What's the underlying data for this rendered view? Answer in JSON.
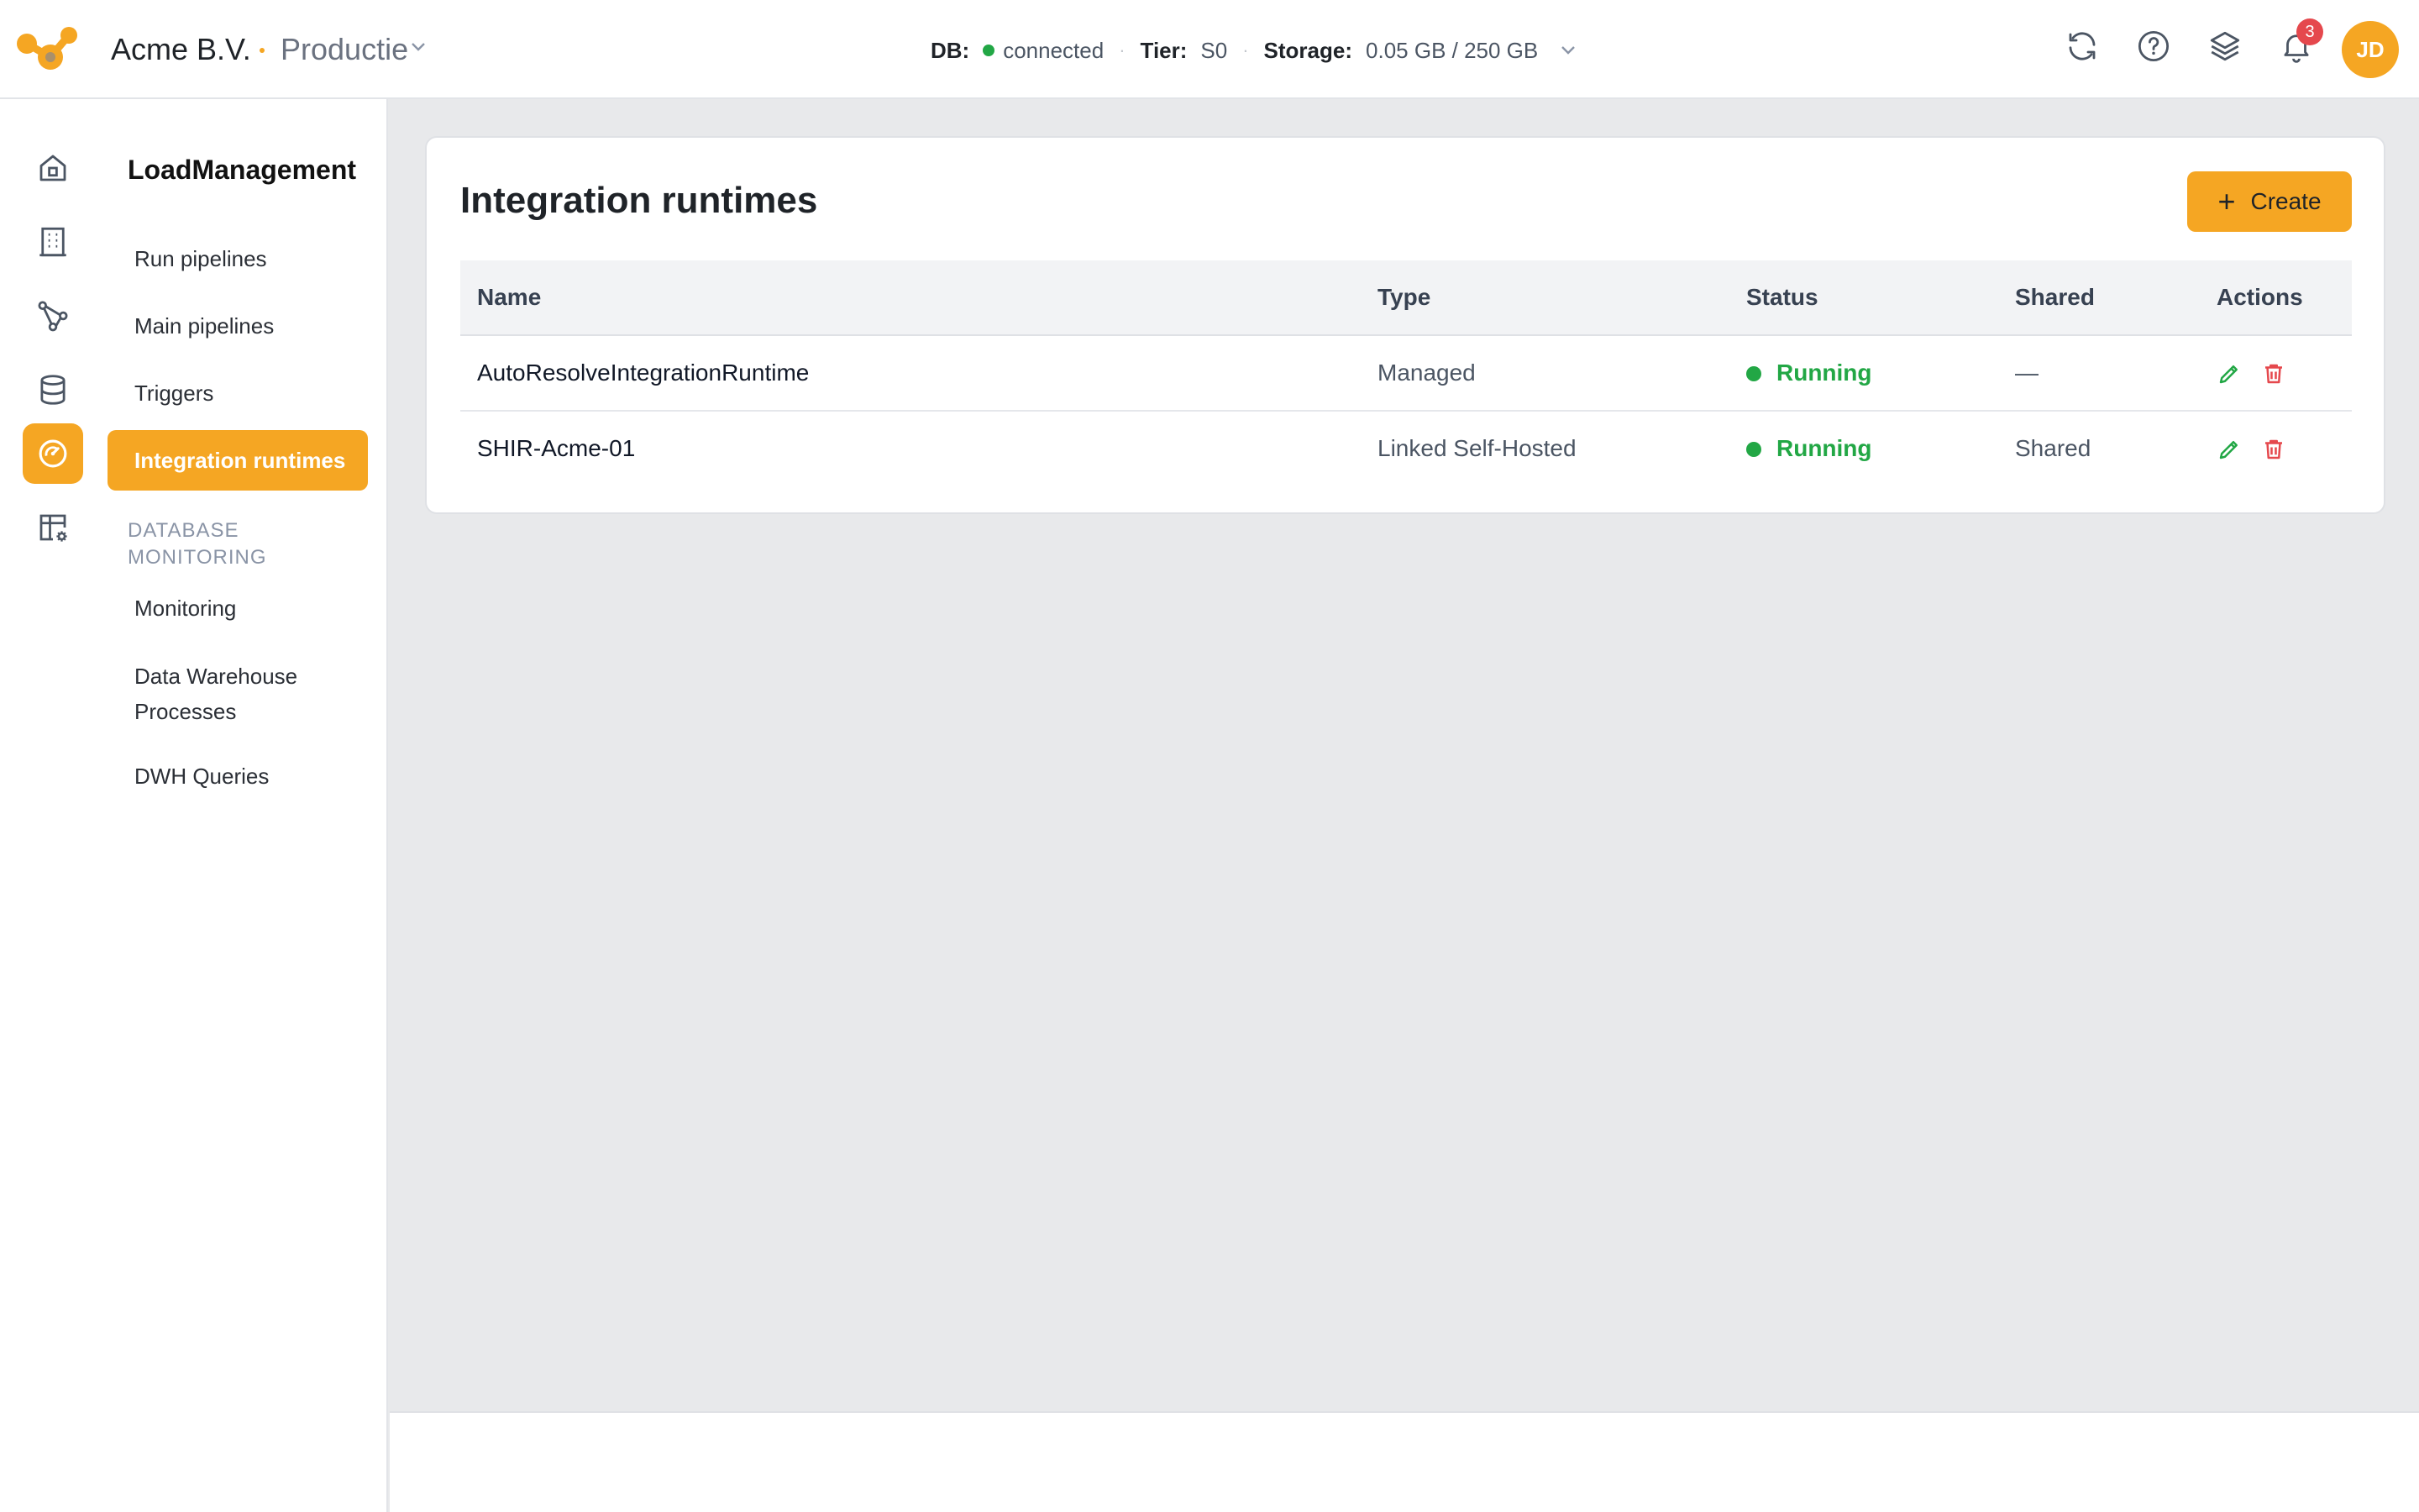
{
  "header": {
    "company": "Acme B.V.",
    "environment": "Productie",
    "db_label": "DB:",
    "db_value": "connected",
    "tier_label": "Tier:",
    "tier_value": "S0",
    "storage_label": "Storage:",
    "storage_value": "0.05 GB / 250 GB",
    "notification_count": "3",
    "avatar_initials": "JD",
    "icons": [
      "refresh-icon",
      "help-icon",
      "layers-icon",
      "bell-icon"
    ]
  },
  "rail": {
    "icons": [
      "home-icon",
      "building-icon",
      "pipeline-icon",
      "database-icon",
      "gauge-icon",
      "table-settings-icon"
    ],
    "active": "gauge-icon"
  },
  "sidebar": {
    "title": "LoadManagement",
    "items": [
      {
        "label": "Run pipelines"
      },
      {
        "label": "Main pipelines"
      },
      {
        "label": "Triggers"
      },
      {
        "label": "Integration runtimes",
        "active": true
      }
    ],
    "section_label": "DATABASE MONITORING",
    "section_items": [
      {
        "label": "Monitoring"
      },
      {
        "label": "Data Warehouse Processes"
      },
      {
        "label": "DWH Queries"
      }
    ]
  },
  "main": {
    "title": "Integration runtimes",
    "create_label": "Create",
    "columns": [
      "Name",
      "Type",
      "Status",
      "Shared",
      "Actions"
    ],
    "rows": [
      {
        "name": "AutoResolveIntegrationRuntime",
        "type": "Managed",
        "status": "Running",
        "shared": "—"
      },
      {
        "name": "SHIR-Acme-01",
        "type": "Linked Self-Hosted",
        "status": "Running",
        "shared": "Shared"
      }
    ]
  },
  "colors": {
    "accent": "#f5a623",
    "success": "#22a745",
    "danger": "#e5484d"
  }
}
